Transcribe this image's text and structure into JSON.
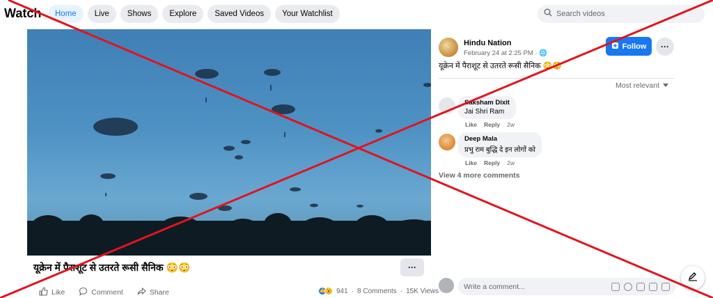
{
  "header": {
    "title": "Watch",
    "tabs": [
      {
        "label": "Home",
        "active": true
      },
      {
        "label": "Live"
      },
      {
        "label": "Shows"
      },
      {
        "label": "Explore"
      },
      {
        "label": "Saved Videos"
      },
      {
        "label": "Your Watchlist"
      }
    ],
    "search_placeholder": "Search videos"
  },
  "video": {
    "title": "यूक्रेन में पैराशूट से उतरते रूसी सैनिक 😳😳",
    "actions": {
      "like": "Like",
      "comment": "Comment",
      "share": "Share"
    },
    "stats": {
      "reactions": "941",
      "comments": "8 Comments",
      "views": "15K Views"
    }
  },
  "post": {
    "page_name": "Hindu Nation",
    "date": "February 24 at 2:25 PM",
    "caption": "यूक्रेन में पैराशूट से उतरते रूसी सैनिक 😳😳",
    "follow_label": "Follow",
    "sort_label": "Most relevant"
  },
  "comments": [
    {
      "author": "Saksham Dixit",
      "text": "Jai Shri Ram",
      "like": "Like",
      "reply": "Reply",
      "time": "2w"
    },
    {
      "author": "Deep Mala",
      "text": "प्रभु राम बुद्धि दे इन लोगों को",
      "like": "Like",
      "reply": "Reply",
      "time": "2w"
    }
  ],
  "view_more": "View 4 more comments",
  "write_comment_placeholder": "Write a comment...",
  "colors": {
    "accent": "#1877f2",
    "cross": "#e0141e"
  }
}
